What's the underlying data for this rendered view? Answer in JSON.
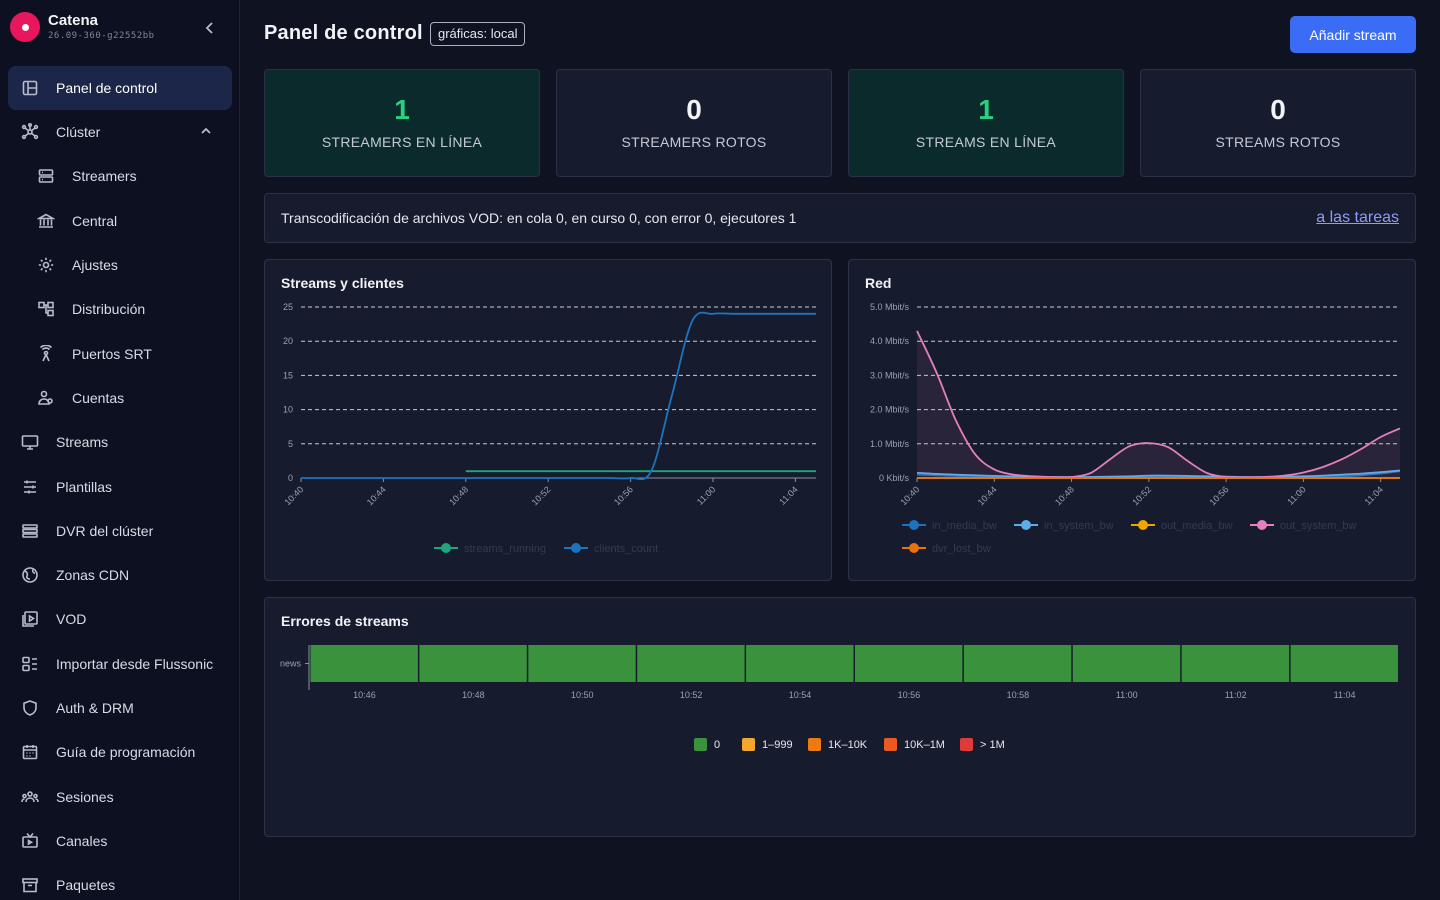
{
  "brand": {
    "name": "Catena",
    "version": "26.09-360-g22552bb"
  },
  "sidebar": {
    "items": [
      {
        "label": "Panel de control",
        "icon": "dashboard-icon",
        "active": true,
        "sub": false
      },
      {
        "label": "Clúster",
        "icon": "cluster-icon",
        "sub": false,
        "expanded": true
      },
      {
        "label": "Streamers",
        "icon": "server-icon",
        "sub": true
      },
      {
        "label": "Central",
        "icon": "bank-icon",
        "sub": true
      },
      {
        "label": "Ajustes",
        "icon": "gear-icon",
        "sub": true
      },
      {
        "label": "Distribución",
        "icon": "distribution-icon",
        "sub": true
      },
      {
        "label": "Puertos SRT",
        "icon": "antenna-icon",
        "sub": true
      },
      {
        "label": "Cuentas",
        "icon": "users-icon",
        "sub": true
      },
      {
        "label": "Streams",
        "icon": "monitor-icon",
        "sub": false
      },
      {
        "label": "Plantillas",
        "icon": "sliders-icon",
        "sub": false
      },
      {
        "label": "DVR del clúster",
        "icon": "list-icon",
        "sub": false
      },
      {
        "label": "Zonas CDN",
        "icon": "globe-icon",
        "sub": false
      },
      {
        "label": "VOD",
        "icon": "play-icon",
        "sub": false
      },
      {
        "label": "Importar desde Flussonic",
        "icon": "import-icon",
        "sub": false
      },
      {
        "label": "Auth & DRM",
        "icon": "shield-icon",
        "sub": false
      },
      {
        "label": "Guía de programación",
        "icon": "calendar-icon",
        "sub": false
      },
      {
        "label": "Sesiones",
        "icon": "people-icon",
        "sub": false
      },
      {
        "label": "Canales",
        "icon": "tv-icon",
        "sub": false
      },
      {
        "label": "Paquetes",
        "icon": "box-icon",
        "sub": false
      }
    ]
  },
  "header": {
    "title": "Panel de control",
    "badge": "gráficas: local",
    "add_button": "Añadir stream"
  },
  "stats": [
    {
      "value": "1",
      "label": "STREAMERS EN LÍNEA",
      "status": "ok"
    },
    {
      "value": "0",
      "label": "STREAMERS ROTOS",
      "status": "neutral"
    },
    {
      "value": "1",
      "label": "STREAMS EN LÍNEA",
      "status": "ok"
    },
    {
      "value": "0",
      "label": "STREAMS ROTOS",
      "status": "neutral"
    }
  ],
  "vod": {
    "text": "Transcodificación de archivos VOD: en cola 0, en curso 0, con error 0, ejecutores 1",
    "link": "a las tareas"
  },
  "chart_data": [
    {
      "type": "line",
      "title": "Streams y clientes",
      "x": [
        "10:40",
        "10:41",
        "10:42",
        "10:43",
        "10:44",
        "10:45",
        "10:46",
        "10:47",
        "10:48",
        "10:49",
        "10:50",
        "10:51",
        "10:52",
        "10:53",
        "10:54",
        "10:55",
        "10:56",
        "10:57",
        "10:58",
        "10:59",
        "11:00",
        "11:01",
        "11:02",
        "11:03",
        "11:04",
        "11:05"
      ],
      "xticks": [
        "10:40",
        "10:44",
        "10:48",
        "10:52",
        "10:56",
        "11:00",
        "11:04"
      ],
      "yticks": [
        0,
        5,
        10,
        15,
        20,
        25
      ],
      "ylim": [
        0,
        25
      ],
      "series": [
        {
          "name": "streams_running",
          "color": "#1fa67a",
          "values": [
            null,
            null,
            null,
            null,
            null,
            null,
            null,
            null,
            1,
            1,
            1,
            1,
            1,
            1,
            1,
            1,
            1,
            1,
            1,
            1,
            1,
            1,
            1,
            1,
            1,
            1
          ]
        },
        {
          "name": "clients_count",
          "color": "#1e73be",
          "values": [
            0,
            0,
            0,
            0,
            0,
            0,
            0,
            0,
            0,
            0,
            0,
            0,
            0,
            0,
            0,
            0,
            0,
            1,
            12,
            23,
            24,
            24,
            24,
            24,
            24,
            24
          ]
        }
      ]
    },
    {
      "type": "line",
      "title": "Red",
      "x": [
        "10:40",
        "10:41",
        "10:42",
        "10:43",
        "10:44",
        "10:45",
        "10:46",
        "10:47",
        "10:48",
        "10:49",
        "10:50",
        "10:51",
        "10:52",
        "10:53",
        "10:54",
        "10:55",
        "10:56",
        "10:57",
        "10:58",
        "10:59",
        "11:00",
        "11:01",
        "11:02",
        "11:03",
        "11:04",
        "11:05"
      ],
      "xticks": [
        "10:40",
        "10:44",
        "10:48",
        "10:52",
        "10:56",
        "11:00",
        "11:04"
      ],
      "ytick_labels": [
        "0 Kbit/s",
        "1.0 Mbit/s",
        "2.0 Mbit/s",
        "3.0 Mbit/s",
        "4.0 Mbit/s",
        "5.0 Mbit/s"
      ],
      "ylim": [
        0,
        5
      ],
      "series": [
        {
          "name": "in_media_bw",
          "color": "#1e73be",
          "values": [
            0.1,
            0.08,
            0.06,
            0.04,
            0.03,
            0.02,
            0.02,
            0.02,
            0.02,
            0.02,
            0.02,
            0.03,
            0.05,
            0.05,
            0.04,
            0.03,
            0.02,
            0.02,
            0.02,
            0.02,
            0.02,
            0.03,
            0.05,
            0.08,
            0.13,
            0.2
          ]
        },
        {
          "name": "in_system_bw",
          "color": "#5aaee8",
          "values": [
            0.15,
            0.12,
            0.1,
            0.08,
            0.06,
            0.05,
            0.04,
            0.03,
            0.03,
            0.03,
            0.04,
            0.05,
            0.07,
            0.07,
            0.06,
            0.05,
            0.04,
            0.03,
            0.03,
            0.04,
            0.05,
            0.07,
            0.1,
            0.13,
            0.17,
            0.22
          ]
        },
        {
          "name": "out_media_bw",
          "color": "#f0a500",
          "values": [
            0,
            0,
            0,
            0,
            0,
            0,
            0,
            0,
            0,
            0,
            0,
            0,
            0,
            0,
            0,
            0,
            0,
            0,
            0,
            0,
            0,
            0,
            0,
            0,
            0,
            0
          ]
        },
        {
          "name": "out_system_bw",
          "color": "#e57fbf",
          "values": [
            4.3,
            3.1,
            1.7,
            0.7,
            0.25,
            0.1,
            0.05,
            0.03,
            0.03,
            0.15,
            0.55,
            0.93,
            1.02,
            0.9,
            0.5,
            0.15,
            0.03,
            0.02,
            0.03,
            0.07,
            0.16,
            0.32,
            0.55,
            0.85,
            1.2,
            1.45
          ]
        },
        {
          "name": "dvr_lost_bw",
          "color": "#e8720c",
          "values": [
            0,
            0,
            0,
            0,
            0,
            0,
            0,
            0,
            0,
            0,
            0,
            0,
            0,
            0,
            0,
            0,
            0,
            0,
            0,
            0,
            0,
            0,
            0,
            0,
            0,
            0
          ]
        }
      ]
    },
    {
      "type": "heatmap",
      "title": "Errores de streams",
      "rows": [
        "news"
      ],
      "x": [
        "10:46",
        "10:48",
        "10:50",
        "10:52",
        "10:54",
        "10:56",
        "10:58",
        "11:00",
        "11:02",
        "11:04"
      ],
      "values": [
        [
          0,
          0,
          0,
          0,
          0,
          0,
          0,
          0,
          0,
          0
        ]
      ],
      "legend": [
        {
          "label": "0",
          "color": "#3a923d"
        },
        {
          "label": "1–999",
          "color": "#f3a72a"
        },
        {
          "label": "1K–10K",
          "color": "#ef7b10"
        },
        {
          "label": "10K–1M",
          "color": "#ec5a1f"
        },
        {
          "label": "> 1M",
          "color": "#e03a3a"
        }
      ]
    }
  ]
}
